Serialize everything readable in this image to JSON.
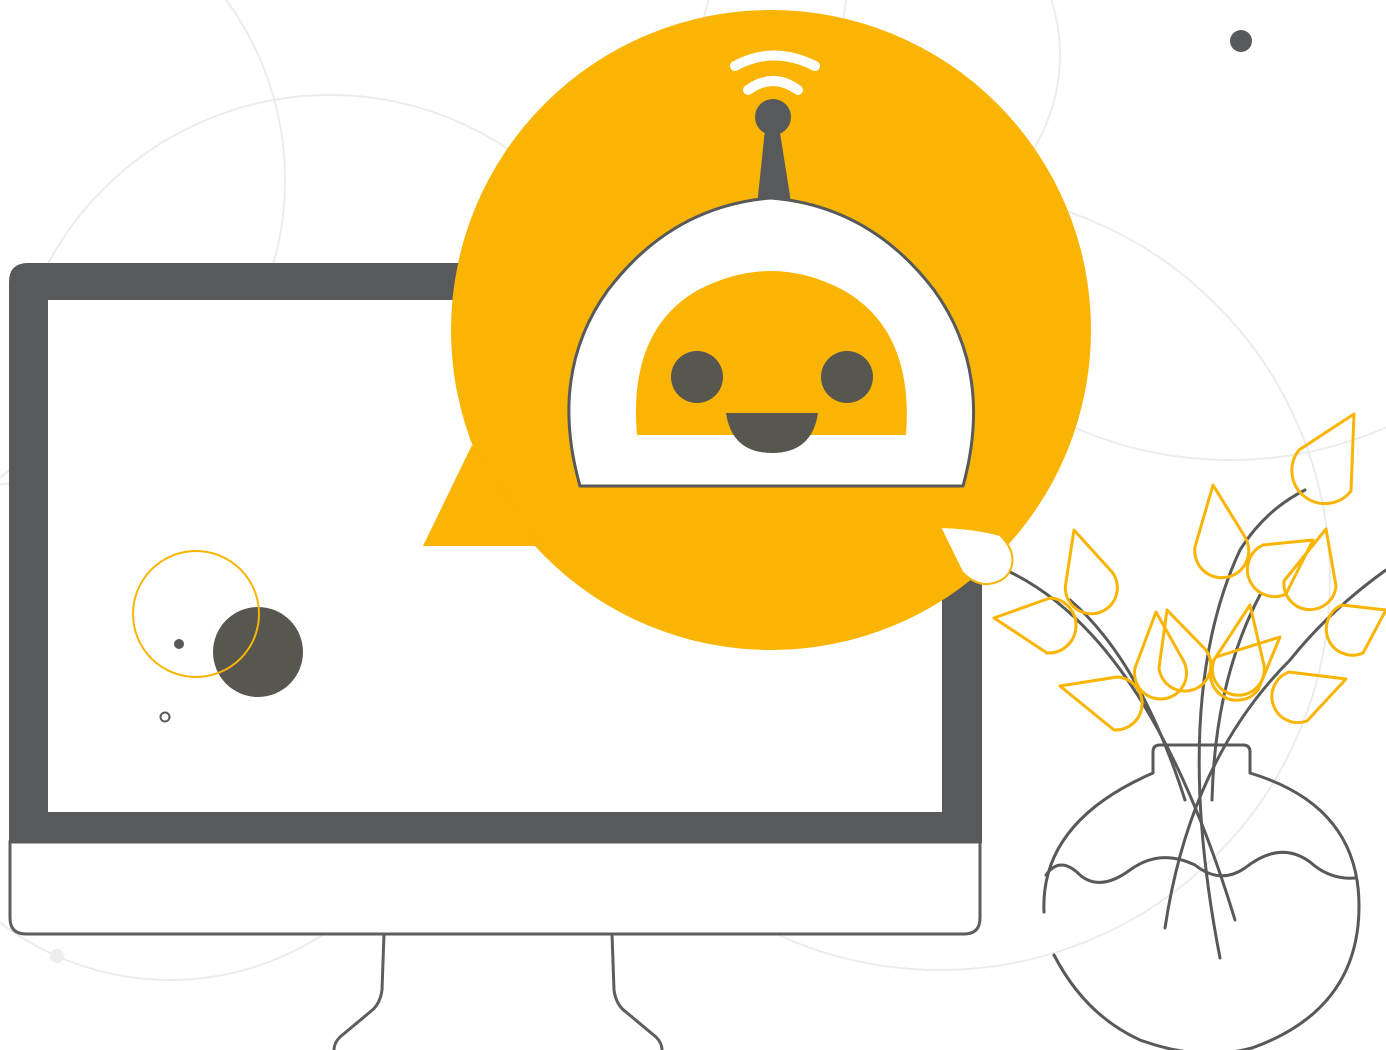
{
  "illustration": {
    "subject": "chatbot-assistant",
    "elements": [
      "background-circles",
      "computer-monitor",
      "chat-bubble",
      "robot-head",
      "wifi-signal-icon",
      "plant-vase"
    ]
  },
  "colors": {
    "accent_yellow": "#F9B404",
    "dark_gray": "#58595B",
    "robot_eye": "#58574F",
    "outline": "#5E5E5E",
    "light_gray": "#EDEDED",
    "white": "#FFFFFF"
  }
}
